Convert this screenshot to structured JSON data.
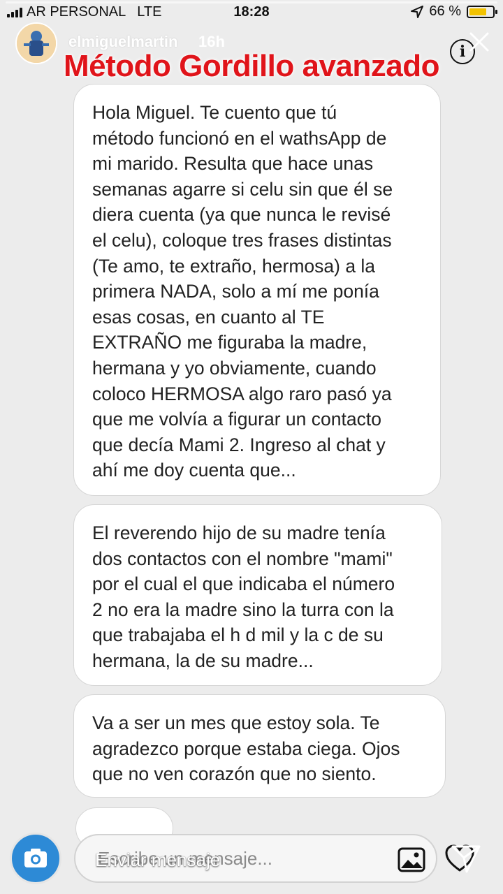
{
  "status_bar": {
    "carrier": "AR PERSONAL",
    "network": "LTE",
    "time": "18:28",
    "battery": "66 %"
  },
  "story": {
    "username": "elmiguelmartin",
    "posted_ago": "16h",
    "overlay_title": "Método Gordillo avanzado",
    "progress": 1.0,
    "title_color": "#e0141a"
  },
  "messages": [
    {
      "lines": [
        "Hola Miguel. Te cuento que tú",
        "método funcionó en el wathsApp de",
        "mi marido. Resulta que hace unas",
        "semanas agarre si celu sin que él se",
        "diera cuenta (ya que nunca le revisé",
        "el celu), coloque tres frases distintas",
        "(Te amo, te extraño, hermosa) a la",
        "primera NADA, solo a mí me ponía",
        "esas cosas, en cuanto al TE",
        "EXTRAÑO me figuraba la madre,",
        "hermana y yo obviamente, cuando",
        "coloco HERMOSA algo raro pasó ya",
        "que me volvía a figurar un contacto",
        "que decía Mami 2. Ingreso al chat y",
        "ahí me doy cuenta que..."
      ]
    },
    {
      "lines": [
        "El reverendo hijo de su madre tenía",
        "dos contactos con el nombre \"mami\"",
        "por el cual el que indicaba el número",
        "2 no era la madre sino la turra con la",
        "que trabajaba el h d mil y la c de su",
        "hermana, la de su madre..."
      ]
    },
    {
      "lines": [
        "Va a ser un mes que estoy sola. Te",
        "agradezco porque estaba ciega. Ojos",
        "que no ven corazón que no siento."
      ]
    }
  ],
  "composer": {
    "placeholder_chat": "Escribe un mensaje...",
    "placeholder_story": "Enviar mensaje"
  },
  "icons": {
    "signal": "signal-bars-icon",
    "location": "location-arrow-icon",
    "battery": "battery-icon",
    "info": "info-icon",
    "close": "close-icon",
    "camera": "camera-icon",
    "gallery": "gallery-icon",
    "heart": "heart-icon",
    "send": "send-icon"
  }
}
